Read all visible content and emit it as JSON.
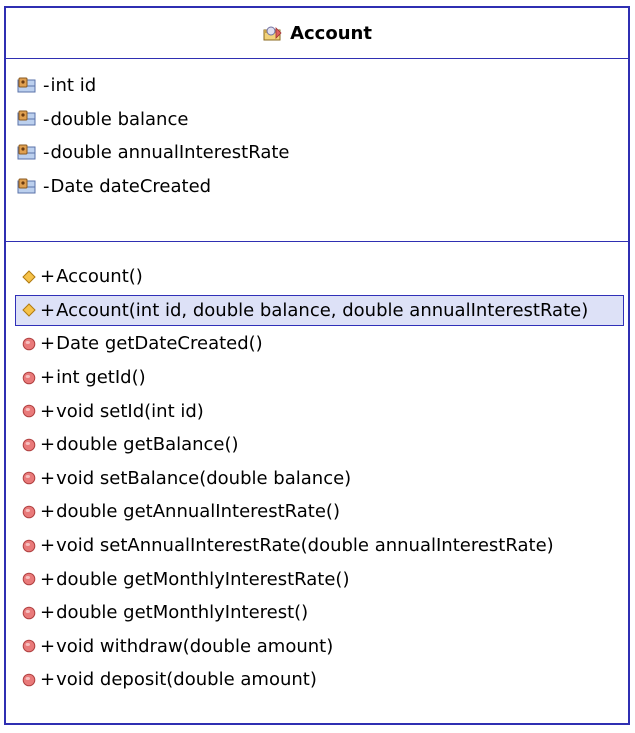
{
  "class": {
    "name": "Account",
    "icon": "class-icon"
  },
  "fields": [
    {
      "visibility": "-",
      "text": "int id",
      "icon": "field-icon"
    },
    {
      "visibility": "-",
      "text": "double balance",
      "icon": "field-icon"
    },
    {
      "visibility": "-",
      "text": "double annualInterestRate",
      "icon": "field-icon"
    },
    {
      "visibility": "-",
      "text": "Date dateCreated",
      "icon": "field-icon"
    }
  ],
  "methods": [
    {
      "visibility": "+",
      "text": "Account()",
      "icon": "constructor-icon",
      "selected": false
    },
    {
      "visibility": "+",
      "text": "Account(int id, double balance, double annualInterestRate)",
      "icon": "constructor-icon",
      "selected": true
    },
    {
      "visibility": "+",
      "text": "Date getDateCreated()",
      "icon": "method-icon",
      "selected": false
    },
    {
      "visibility": "+",
      "text": "int getId()",
      "icon": "method-icon",
      "selected": false
    },
    {
      "visibility": "+",
      "text": "void setId(int id)",
      "icon": "method-icon",
      "selected": false
    },
    {
      "visibility": "+",
      "text": "double getBalance()",
      "icon": "method-icon",
      "selected": false
    },
    {
      "visibility": "+",
      "text": "void setBalance(double balance)",
      "icon": "method-icon",
      "selected": false
    },
    {
      "visibility": "+",
      "text": "double getAnnualInterestRate()",
      "icon": "method-icon",
      "selected": false
    },
    {
      "visibility": "+",
      "text": "void setAnnualInterestRate(double annualInterestRate)",
      "icon": "method-icon",
      "selected": false
    },
    {
      "visibility": "+",
      "text": "double getMonthlyInterestRate()",
      "icon": "method-icon",
      "selected": false
    },
    {
      "visibility": "+",
      "text": "double getMonthlyInterest()",
      "icon": "method-icon",
      "selected": false
    },
    {
      "visibility": "+",
      "text": "void withdraw(double amount)",
      "icon": "method-icon",
      "selected": false
    },
    {
      "visibility": "+",
      "text": "void deposit(double amount)",
      "icon": "method-icon",
      "selected": false
    }
  ],
  "colors": {
    "border": "#2f2fb2",
    "selection_fill": "#dde1f7",
    "method_icon": "#e06060",
    "constructor_icon": "#f0b030"
  }
}
